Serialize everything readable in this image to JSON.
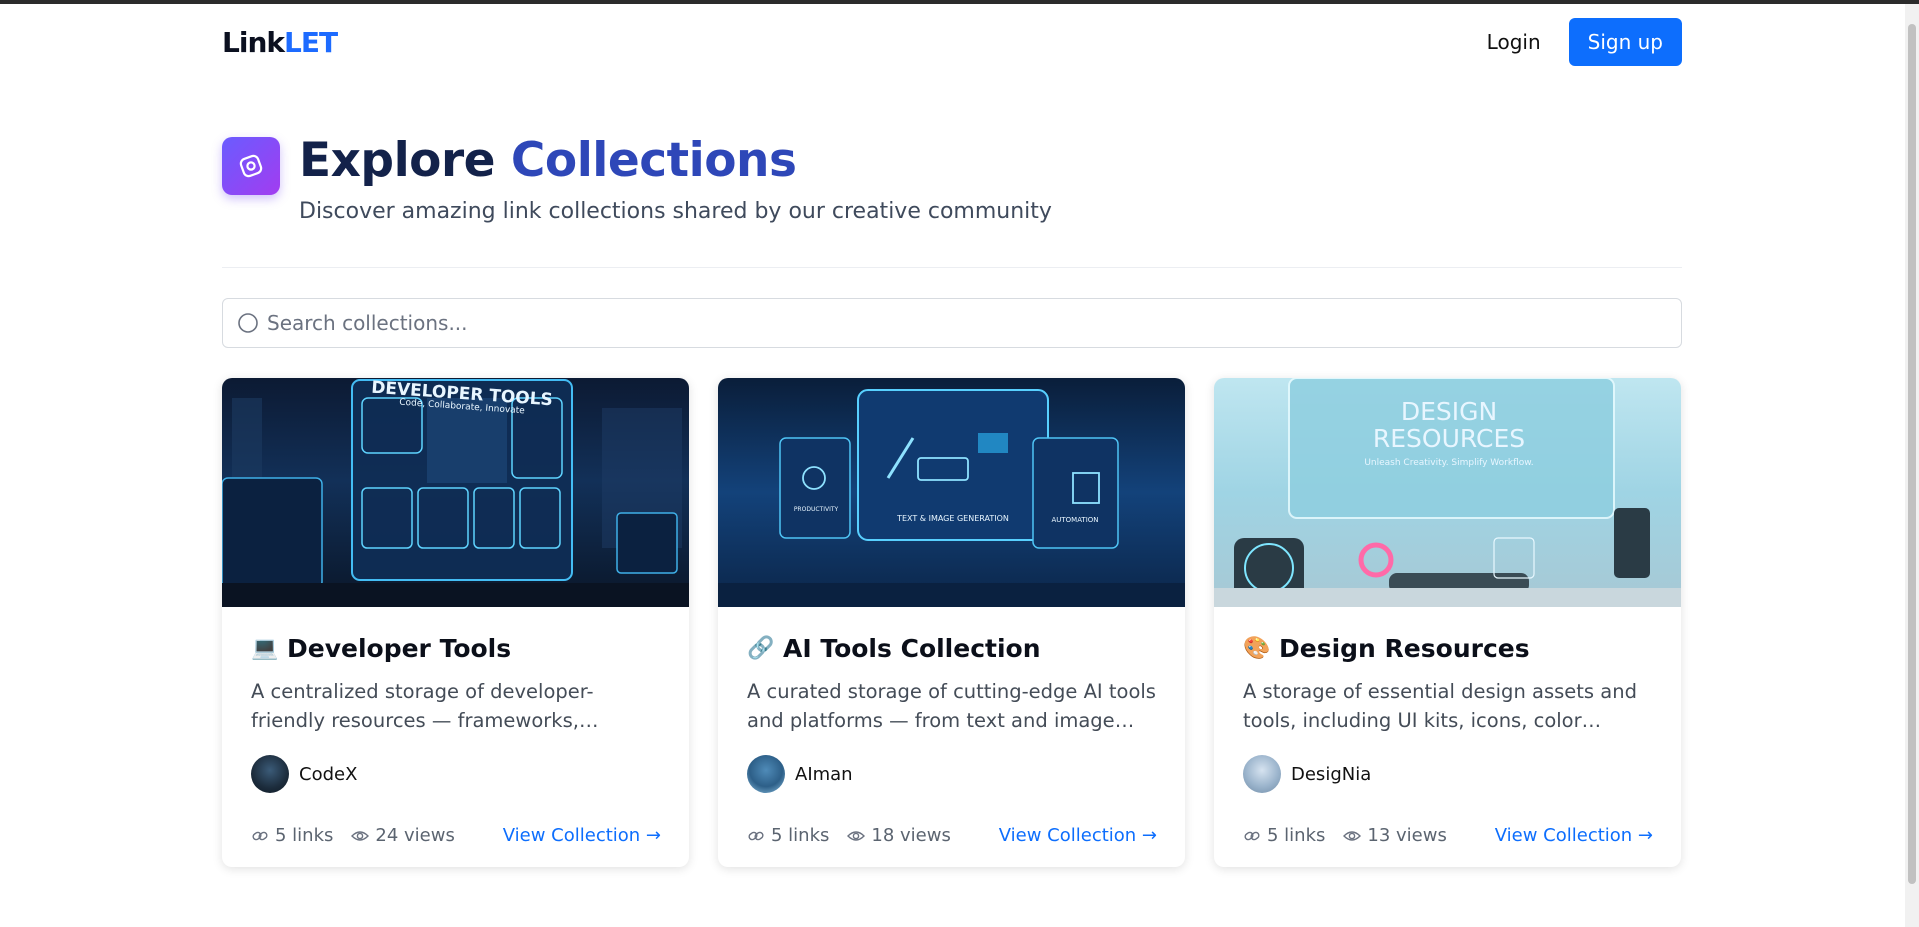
{
  "header": {
    "logo_main": "Link",
    "logo_accent": "LET",
    "login_label": "Login",
    "signup_label": "Sign up"
  },
  "hero": {
    "title_main": "Explore",
    "title_accent": "Collections",
    "subtitle": "Discover amazing link collections shared by our creative community",
    "icon": "compass-icon"
  },
  "search": {
    "placeholder": "Search collections...",
    "value": ""
  },
  "colors": {
    "accent": "#0d6efd",
    "hero_icon_gradient": [
      "#6a5cff",
      "#a23cf0"
    ]
  },
  "cards": [
    {
      "emoji": "💻",
      "title": "Developer Tools",
      "description": "A centralized storage of developer-friendly resources — frameworks, libraries, tools and more.",
      "author": "CodeX",
      "links": "5 links",
      "views": "24 views",
      "link_label": "View Collection →",
      "image_text": "DEVELOPER TOOLS",
      "image_subtext": "Code, Collaborate, Innovate"
    },
    {
      "emoji": "🔗",
      "title": "AI Tools Collection",
      "description": "A curated storage of cutting-edge AI tools and platforms — from text and image generation to productivity and automation.",
      "author": "AIman",
      "links": "5 links",
      "views": "18 views",
      "link_label": "View Collection →",
      "image_labels": [
        "PRODUCTIVITY",
        "TEXT & IMAGE GENERATION",
        "AUTOMATION"
      ]
    },
    {
      "emoji": "🎨",
      "title": "Design Resources",
      "description": "A storage of essential design assets and tools, including UI kits, icons, color palettes and more.",
      "author": "DesigNia",
      "links": "5 links",
      "views": "13 views",
      "link_label": "View Collection →",
      "image_text": "DESIGN RESOURCES",
      "image_subtext": "Unleash Creativity. Simplify Workflow."
    }
  ]
}
